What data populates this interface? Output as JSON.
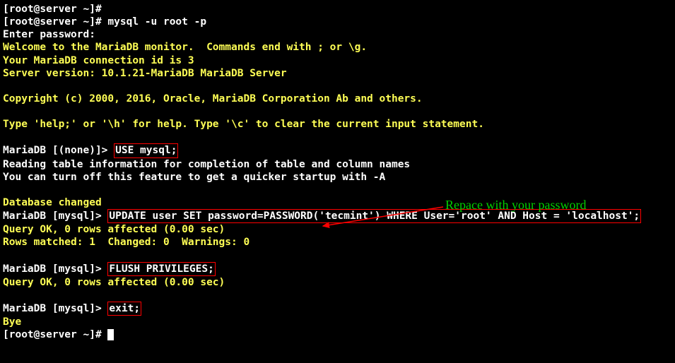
{
  "lines": [
    {
      "prompt": "[root@server ~]# ",
      "cmd": ""
    },
    {
      "prompt": "[root@server ~]# ",
      "cmd": "mysql -u root -p"
    },
    {
      "text": "Enter password:"
    },
    {
      "text_y": "Welcome to the MariaDB monitor.  Commands end with ; or \\g."
    },
    {
      "text_y": "Your MariaDB connection id is 3"
    },
    {
      "text_y": "Server version: 10.1.21-MariaDB MariaDB Server"
    },
    {
      "blank": true
    },
    {
      "text_y": "Copyright (c) 2000, 2016, Oracle, MariaDB Corporation Ab and others."
    },
    {
      "blank": true
    },
    {
      "text_y": "Type 'help;' or '\\h' for help. Type '\\c' to clear the current input statement."
    },
    {
      "blank": true
    },
    {
      "db_prompt": "MariaDB [(none)]> ",
      "boxed_cmd": "USE mysql;"
    },
    {
      "text": "Reading table information for completion of table and column names"
    },
    {
      "text": "You can turn off this feature to get a quicker startup with -A"
    },
    {
      "blank": true
    },
    {
      "text_y": "Database changed"
    },
    {
      "db_prompt": "MariaDB [mysql]> ",
      "boxed_cmd": "UPDATE user SET password=PASSWORD('tecmint') WHERE User='root' AND Host = 'localhost';"
    },
    {
      "text_y": "Query OK, 0 rows affected (0.00 sec)"
    },
    {
      "text_y": "Rows matched: 1  Changed: 0  Warnings: 0"
    },
    {
      "blank": true
    },
    {
      "db_prompt": "MariaDB [mysql]> ",
      "boxed_cmd": "FLUSH PRIVILEGES;"
    },
    {
      "text_y": "Query OK, 0 rows affected (0.00 sec)"
    },
    {
      "blank": true
    },
    {
      "db_prompt": "MariaDB [mysql]> ",
      "boxed_cmd": "exit;"
    },
    {
      "text_y": "Bye"
    },
    {
      "prompt": "[root@server ~]# ",
      "cursor": true
    }
  ],
  "annotation": "Repace with your password",
  "colors": {
    "bg": "#000000",
    "text": "#ffffff",
    "yellow": "#ffff55",
    "box": "#ff0000",
    "note": "#00d000"
  }
}
